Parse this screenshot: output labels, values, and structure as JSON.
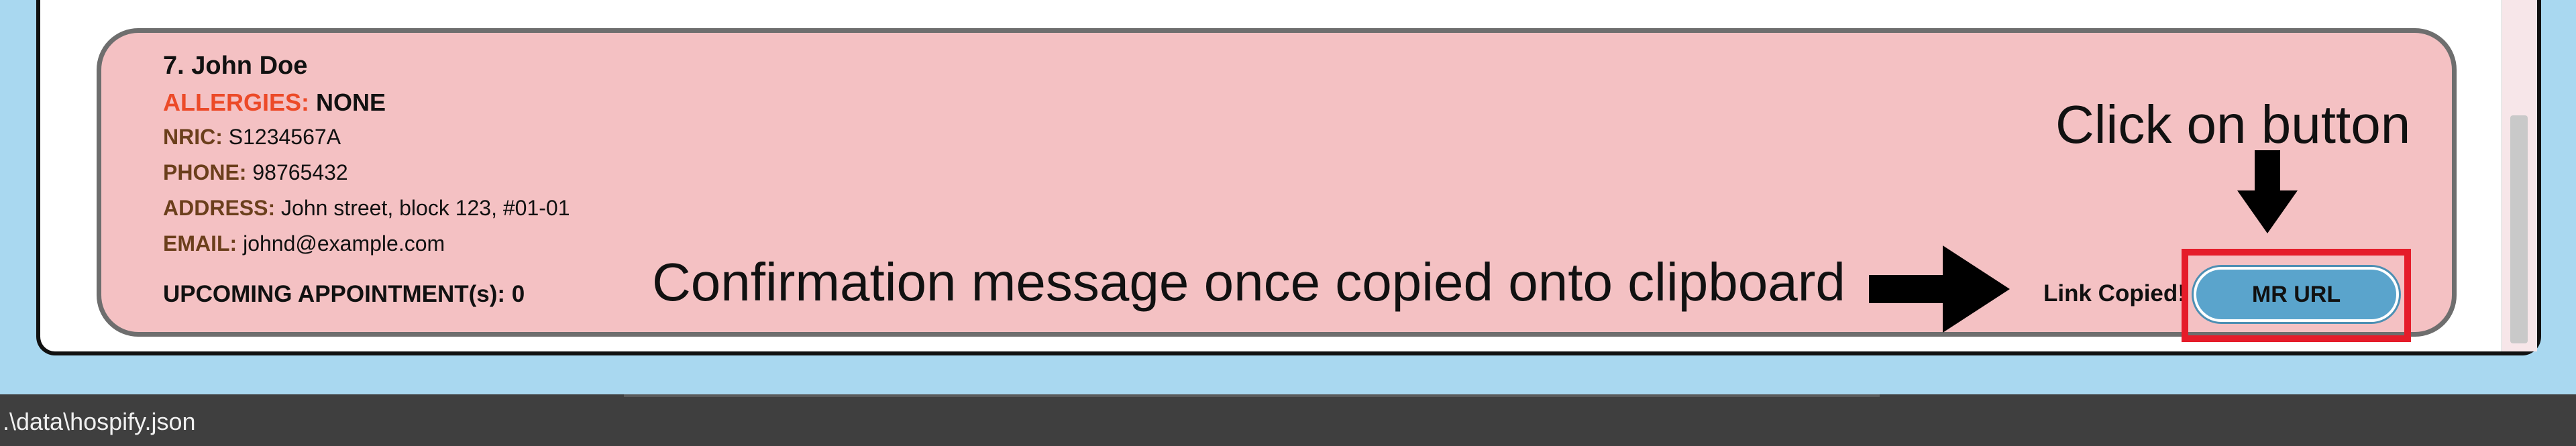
{
  "patient": {
    "index_name": "7.  John Doe",
    "allergies_label": "ALLERGIES:",
    "allergies_value": "NONE",
    "nric_label": "NRIC:",
    "nric_value": "S1234567A",
    "phone_label": "PHONE:",
    "phone_value": "98765432",
    "address_label": "ADDRESS:",
    "address_value": "John street, block 123, #01-01",
    "email_label": "EMAIL:",
    "email_value": "johnd@example.com",
    "appointments": "UPCOMING APPOINTMENT(s): 0"
  },
  "mr_url_button": {
    "label": "MR URL"
  },
  "confirmation": {
    "text": "Link Copied!"
  },
  "annotations": {
    "confirmation_note": "Confirmation message once copied onto clipboard",
    "click_note": "Click on button"
  },
  "status_bar": {
    "path": ".\\data\\hospify.json"
  },
  "colors": {
    "card_background": "#f4c1c3",
    "allergies_label": "#ec4a28",
    "field_label": "#6b3f1c",
    "button": "#5aa4cc",
    "highlight": "#e51c2a",
    "page_background": "#a9d8f0",
    "status_bar": "#3f3f3f"
  },
  "icons": {
    "right_arrow": "right-arrow-icon",
    "down_arrow": "down-arrow-icon"
  }
}
